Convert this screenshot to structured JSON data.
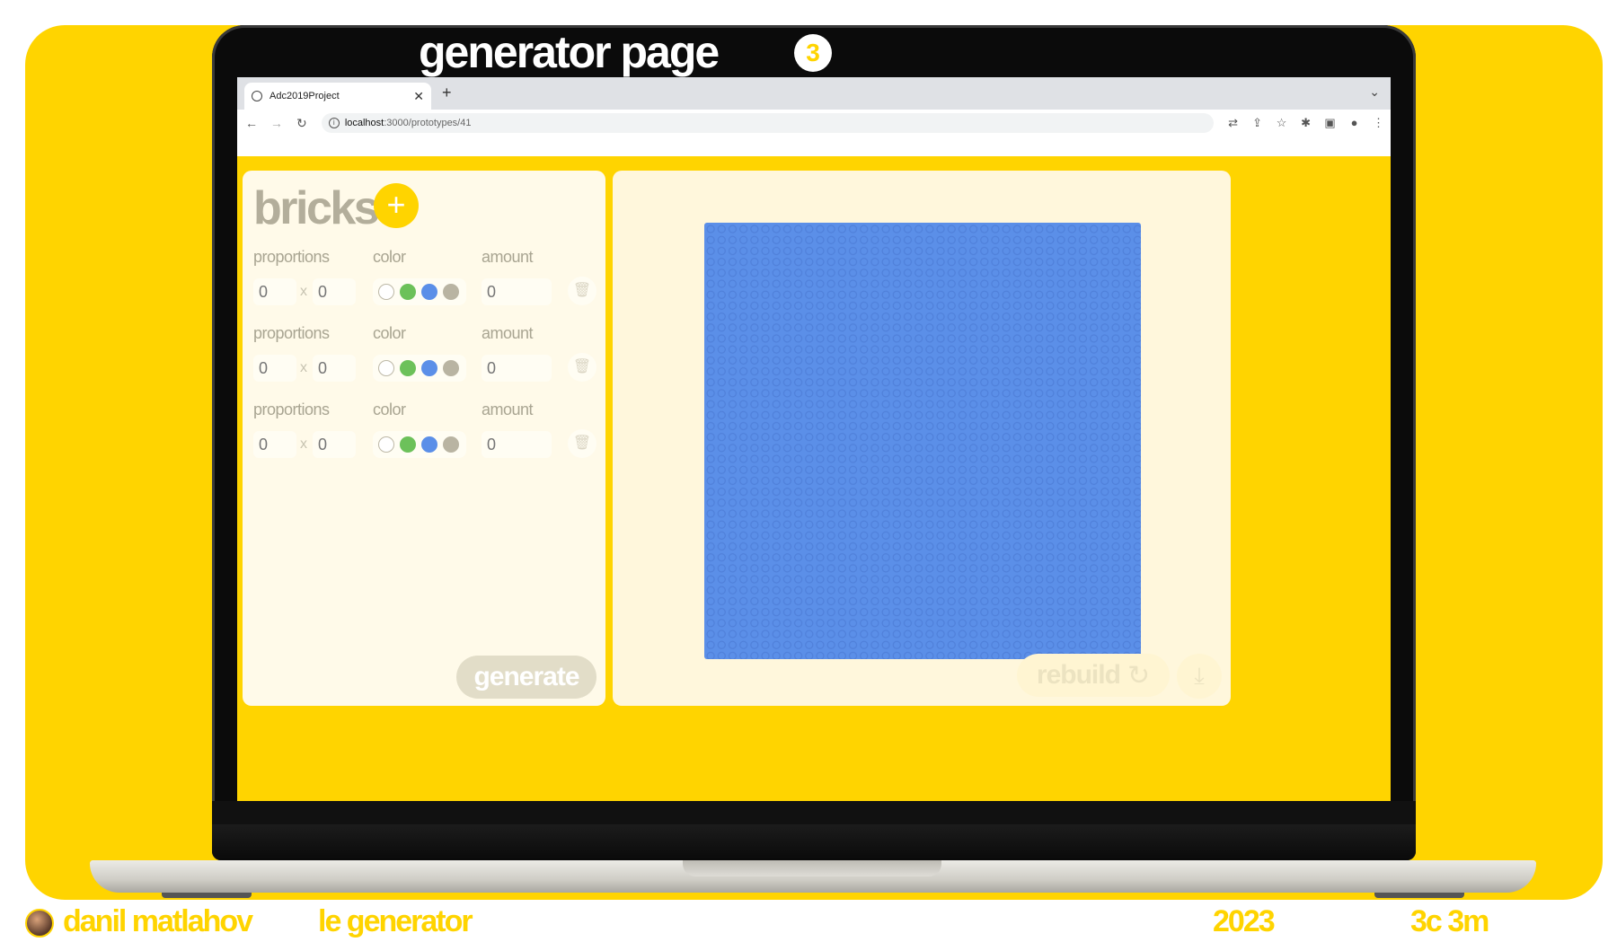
{
  "hero": {
    "title": "generator page",
    "number": "3"
  },
  "browser": {
    "tab_title": "Adc2019Project",
    "tab_close": "✕",
    "new_tab": "+",
    "url_host": "localhost",
    "url_path": ":3000/prototypes/41"
  },
  "app": {
    "title": "bricks",
    "add_label": "+",
    "labels": {
      "proportions": "proportions",
      "color": "color",
      "amount": "amount",
      "x": "x"
    },
    "rows": [
      {
        "width_placeholder": "0",
        "height_placeholder": "0",
        "amount_placeholder": "0"
      },
      {
        "width_placeholder": "0",
        "height_placeholder": "0",
        "amount_placeholder": "0"
      },
      {
        "width_placeholder": "0",
        "height_placeholder": "0",
        "amount_placeholder": "0"
      }
    ],
    "colors": [
      "#ffffff",
      "#6cc15a",
      "#5b8fe8",
      "#b9b4a2"
    ],
    "generate_label": "generate",
    "canvas_color": "#5b8fe8",
    "rebuild_label": "rebuild"
  },
  "footer": {
    "author": "danil matlahov",
    "project": "le generator",
    "year": "2023",
    "duration": "3c 3m"
  },
  "accent": "#FFD400"
}
